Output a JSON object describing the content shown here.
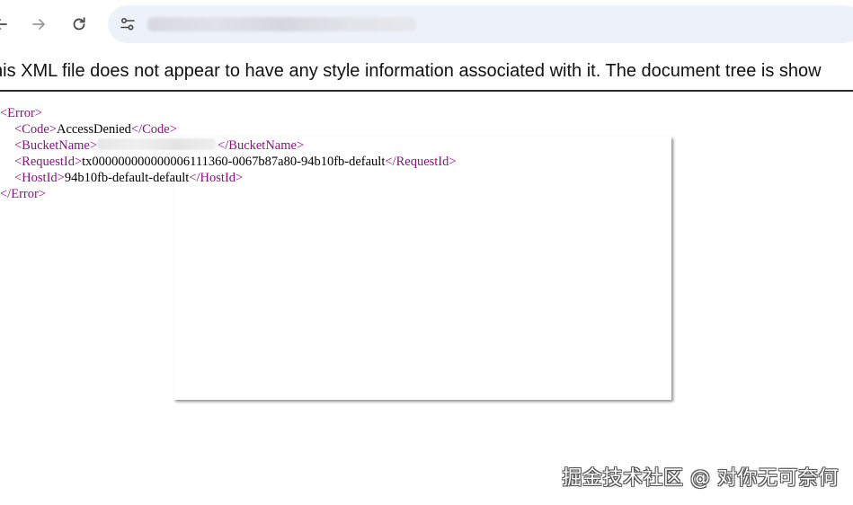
{
  "browser": {
    "url": "",
    "icons": {
      "back": "arrow-left-icon",
      "forward": "arrow-right-icon",
      "reload": "reload-icon",
      "site_info": "tune-icon"
    }
  },
  "xml_viewer": {
    "header": "his XML file does not appear to have any style information associated with it. The document tree is show",
    "tree": {
      "root_open": "<Error>",
      "root_close": "</Error>",
      "code": {
        "open": "<Code>",
        "value": "AccessDenied",
        "close": "</Code>"
      },
      "bucket_name": {
        "open": "<BucketName>",
        "value": "",
        "close": "</BucketName>"
      },
      "request_id": {
        "open": "<RequestId>",
        "value": "tx000000000000006111360-0067b87a80-94b10fb-default",
        "close": "</RequestId>"
      },
      "host_id": {
        "open": "<HostId>",
        "value": "94b10fb-default-default",
        "close": "</HostId>"
      }
    }
  },
  "watermark": "掘金技术社区 @ 对你无可奈何",
  "colors": {
    "tag": "#881280",
    "omnibox_bg": "#edf2fa",
    "text": "#111111"
  }
}
